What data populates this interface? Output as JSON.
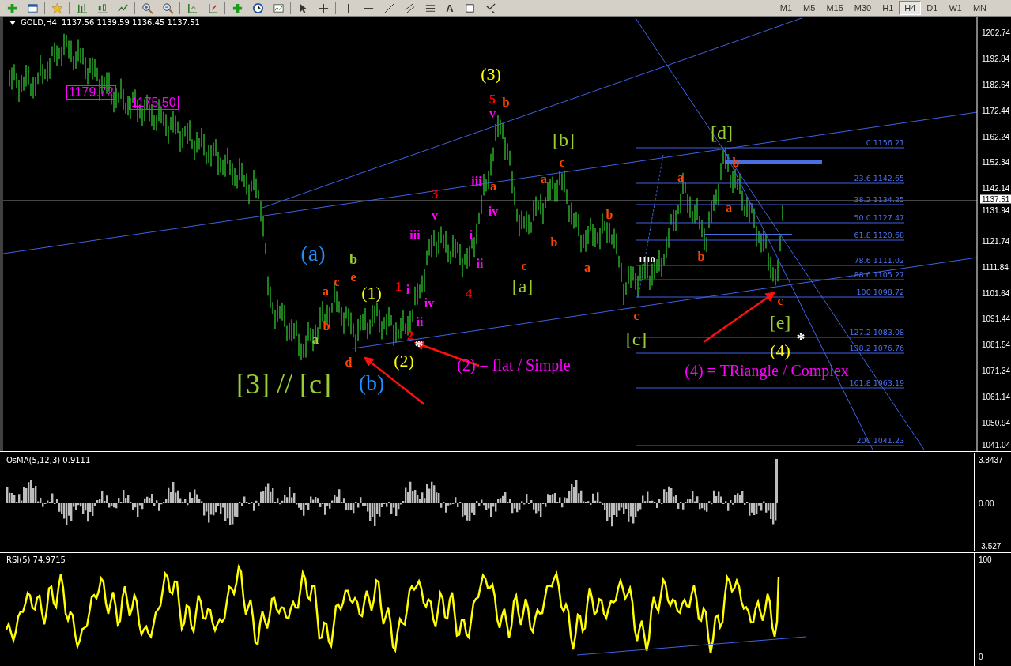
{
  "toolbar": {
    "text_tool": "A",
    "timeframes": [
      {
        "label": "M1",
        "selected": false
      },
      {
        "label": "M5",
        "selected": false
      },
      {
        "label": "M15",
        "selected": false
      },
      {
        "label": "M30",
        "selected": false
      },
      {
        "label": "H1",
        "selected": false
      },
      {
        "label": "H4",
        "selected": true
      },
      {
        "label": "D1",
        "selected": false
      },
      {
        "label": "W1",
        "selected": false
      },
      {
        "label": "MN",
        "selected": false
      }
    ]
  },
  "chart": {
    "header": {
      "symbol": "GOLD,H4",
      "ohlc": "1137.56 1139.59 1136.45 1137.51"
    },
    "price_labels": [
      "1202.74",
      "1192.84",
      "1182.64",
      "1172.44",
      "1162.24",
      "1152.34",
      "1142.14",
      "1131.94",
      "1121.74",
      "1111.84",
      "1101.64",
      "1091.44",
      "1081.54",
      "1071.34",
      "1061.14",
      "1050.94",
      "1041.04"
    ],
    "current_price": "1137.51",
    "price_boxes": [
      "1179.72",
      "1175.50"
    ],
    "fibonacci_levels": [
      "0 1156.21",
      "23.6 1142.65",
      "38.2 1134.25",
      "50.0 1127.47",
      "61.8 1120.68",
      "78.6 1111.02",
      "88.6 1105.27",
      "100 1098.72",
      "127.2 1083.08",
      "138.2 1076.76",
      "161.8 1063.19",
      "200 1041.23"
    ],
    "wave_labels": [
      {
        "text": "(3)",
        "color": "#ffff00"
      },
      {
        "text": "5",
        "color": "#ff0000"
      },
      {
        "text": "b",
        "color": "#ff4500"
      },
      {
        "text": "v",
        "color": "#ff00ff"
      },
      {
        "text": "[b]",
        "color": "#9acd32"
      },
      {
        "text": "[d]",
        "color": "#9acd32"
      },
      {
        "text": "c",
        "color": "#ff4500"
      },
      {
        "text": "a",
        "color": "#ff4500"
      },
      {
        "text": "b",
        "color": "#ff4500"
      },
      {
        "text": "iii",
        "color": "#ff00ff"
      },
      {
        "text": "a",
        "color": "#ff4500"
      },
      {
        "text": "a",
        "color": "#ff4500"
      },
      {
        "text": "3",
        "color": "#ff0000"
      },
      {
        "text": "v",
        "color": "#ff00ff"
      },
      {
        "text": "iv",
        "color": "#ff00ff"
      },
      {
        "text": "b",
        "color": "#ff4500"
      },
      {
        "text": "a",
        "color": "#ff4500"
      },
      {
        "text": "iii",
        "color": "#ff00ff"
      },
      {
        "text": "i",
        "color": "#ff00ff"
      },
      {
        "text": "b",
        "color": "#ff4500"
      },
      {
        "text": "(a)",
        "color": "#1e90ff"
      },
      {
        "text": "b",
        "color": "#9acd32"
      },
      {
        "text": "ii",
        "color": "#ff00ff"
      },
      {
        "text": "c",
        "color": "#ff4500"
      },
      {
        "text": "1110",
        "color": "#ffffff"
      },
      {
        "text": "b",
        "color": "#ff4500"
      },
      {
        "text": "a",
        "color": "#ff4500"
      },
      {
        "text": "c",
        "color": "#ff4500"
      },
      {
        "text": "e",
        "color": "#ff4500"
      },
      {
        "text": "(1)",
        "color": "#ffff00"
      },
      {
        "text": "1",
        "color": "#ff0000"
      },
      {
        "text": "i",
        "color": "#ff00ff"
      },
      {
        "text": "4",
        "color": "#ff0000"
      },
      {
        "text": "[a]",
        "color": "#9acd32"
      },
      {
        "text": "a",
        "color": "#ff4500"
      },
      {
        "text": "iv",
        "color": "#ff00ff"
      },
      {
        "text": "c",
        "color": "#ff4500"
      },
      {
        "text": "b",
        "color": "#ff4500"
      },
      {
        "text": "ii",
        "color": "#ff00ff"
      },
      {
        "text": "a",
        "color": "#9acd32"
      },
      {
        "text": "2",
        "color": "#ff0000"
      },
      {
        "text": "c",
        "color": "#ff4500"
      },
      {
        "text": "[e]",
        "color": "#9acd32"
      },
      {
        "text": "[c]",
        "color": "#9acd32"
      },
      {
        "text": "(2)",
        "color": "#ffff00"
      },
      {
        "text": "(4)",
        "color": "#ffff00"
      },
      {
        "text": "d",
        "color": "#ff4500"
      },
      {
        "text": "[3] // [c]",
        "color": "#9acd32"
      },
      {
        "text": "(b)",
        "color": "#1e90ff"
      },
      {
        "text": "(2) = flat / Simple",
        "color": "#ff00ff"
      },
      {
        "text": "(4) = TRiangle / Complex",
        "color": "#ff00ff"
      },
      {
        "text": "*",
        "color": "#ffffff"
      },
      {
        "text": "*",
        "color": "#ffffff"
      }
    ]
  },
  "osma": {
    "title": "OsMA(5,12,3) 0.9111",
    "scale": [
      "3.8437",
      "0.00",
      "-3.527"
    ]
  },
  "rsi": {
    "title": "RSI(5) 74.9715",
    "scale": [
      "100",
      "0"
    ]
  }
}
